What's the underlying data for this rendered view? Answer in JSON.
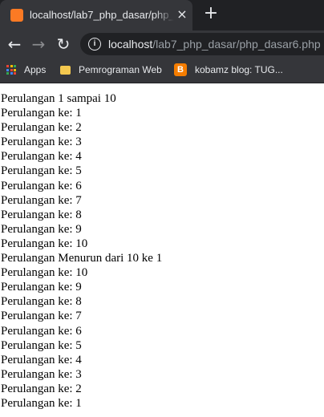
{
  "browser": {
    "tab": {
      "title": "localhost/lab7_php_dasar/php_dasar6.php",
      "icon": "xampp-icon",
      "close": "×"
    },
    "new_tab": "+",
    "nav": {
      "back": "←",
      "forward": "→",
      "reload": "↻"
    },
    "url": {
      "host": "localhost",
      "path": "/lab7_php_dasar/php_dasar6.php"
    },
    "bookmarks": [
      {
        "label": "Apps",
        "icon": "apps-grid-icon"
      },
      {
        "label": "Pemrograman Web",
        "icon": "folder-icon"
      },
      {
        "label": "kobamz blog: TUG...",
        "icon": "blogger-icon"
      }
    ],
    "colors": {
      "tabstrip": "#202124",
      "toolbar": "#35363a",
      "accent": "#fb7a24"
    }
  },
  "page": {
    "lines": [
      "Perulangan 1 sampai 10",
      "Perulangan ke: 1",
      "Perulangan ke: 2",
      "Perulangan ke: 3",
      "Perulangan ke: 4",
      "Perulangan ke: 5",
      "Perulangan ke: 6",
      "Perulangan ke: 7",
      "Perulangan ke: 8",
      "Perulangan ke: 9",
      "Perulangan ke: 10",
      "Perulangan Menurun dari 10 ke 1",
      "Perulangan ke: 10",
      "Perulangan ke: 9",
      "Perulangan ke: 8",
      "Perulangan ke: 7",
      "Perulangan ke: 6",
      "Perulangan ke: 5",
      "Perulangan ke: 4",
      "Perulangan ke: 3",
      "Perulangan ke: 2",
      "Perulangan ke: 1"
    ]
  }
}
